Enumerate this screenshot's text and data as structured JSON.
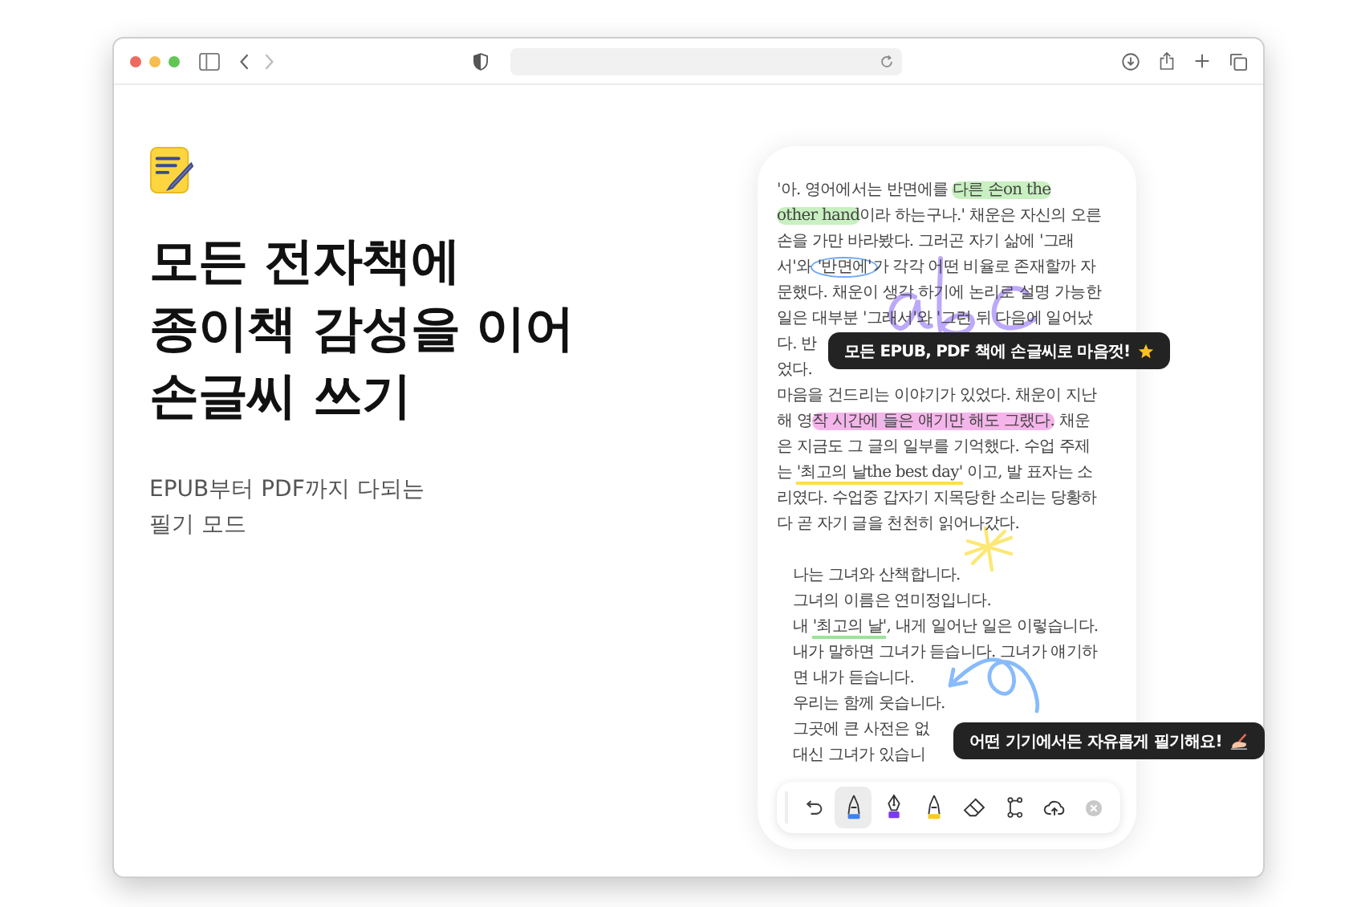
{
  "hero": {
    "title_lines": [
      "모든 전자책에",
      "종이책 감성을 이어",
      "손글씨 쓰기"
    ],
    "subtitle_lines": [
      "EPUB부터 PDF까지 다되는",
      "필기 모드"
    ]
  },
  "reader": {
    "paragraphs": [
      {
        "kind": "body",
        "lines": [
          [
            {
              "text": "'아. 영어에서는 반면에를 ",
              "kind": "plain"
            },
            {
              "text": "다른 손on the",
              "kind": "highlight",
              "color": "#c8f0c0"
            }
          ],
          [
            {
              "text": "other hand",
              "kind": "highlight",
              "color": "#c8f0c0"
            },
            {
              "text": "이라 하는구나.' 채운은 자신의 오른",
              "kind": "plain"
            }
          ],
          [
            {
              "text": "손을 가만 바라봤다. 그러곤 자기 삶에 '그래",
              "kind": "plain"
            }
          ],
          [
            {
              "text": "서'와 ",
              "kind": "plain"
            },
            {
              "text": "'반면에'",
              "kind": "circled",
              "color": "#6ea8f5"
            },
            {
              "text": "가 각각 어떤 비율로 존재할까 자",
              "kind": "plain"
            }
          ],
          [
            {
              "text": "문했다. 채운이 생각 하기에 논리로 설명 가능한",
              "kind": "plain"
            }
          ],
          [
            {
              "text": "일은 대부분 '그래서'와 '그런 뒤 다음에 일어났",
              "kind": "plain"
            }
          ],
          [
            {
              "text": "다. 반",
              "kind": "plain"
            }
          ],
          [
            {
              "text": "었다.",
              "kind": "plain"
            }
          ],
          [
            {
              "text": "마음을 건드리는 이야기가 있었다. 채운이 지난",
              "kind": "plain"
            }
          ],
          [
            {
              "text": "해 영",
              "kind": "plain"
            },
            {
              "text": "작 시간에 들은 얘기만 해도 그랬다.",
              "kind": "highlight",
              "color": "#f4b6ea"
            },
            {
              "text": " 채운",
              "kind": "plain"
            }
          ],
          [
            {
              "text": "은 지금도 그 글의 일부를 기억했다. 수업 주제",
              "kind": "plain"
            }
          ],
          [
            {
              "text": "는 ",
              "kind": "plain"
            },
            {
              "text": "'최고의 날the best day'",
              "kind": "underline",
              "color": "#fde047"
            },
            {
              "text": " 이고, 발 표자는 소",
              "kind": "plain"
            }
          ],
          [
            {
              "text": "리였다. 수업중 갑자기 지목당한 소리는 당황하",
              "kind": "plain"
            }
          ],
          [
            {
              "text": "다 곧 자기 글을 천천히 읽어나갔다.",
              "kind": "plain"
            }
          ]
        ]
      },
      {
        "kind": "quote",
        "lines": [
          [
            {
              "text": "나는 그녀와 산책합니다.",
              "kind": "plain"
            }
          ],
          [
            {
              "text": "그녀의 이름은 연미정입니다.",
              "kind": "plain"
            }
          ],
          [
            {
              "text": "내 ",
              "kind": "plain"
            },
            {
              "text": "'최고의 날'",
              "kind": "underline",
              "color": "#9be39b"
            },
            {
              "text": ", 내게 일어난 일은 이렇습니다.",
              "kind": "plain"
            }
          ],
          [
            {
              "text": "내가 말하면 그녀가 듣습니다.  그녀가 얘기하",
              "kind": "plain"
            }
          ],
          [
            {
              "text": "면 내가 듣습니다.",
              "kind": "plain"
            }
          ],
          [
            {
              "text": "우리는 함께 웃습니다.",
              "kind": "plain"
            }
          ],
          [
            {
              "text": "그곳에 큰 사전은 없",
              "kind": "plain"
            }
          ],
          [
            {
              "text": "대신 그녀가 있습니",
              "kind": "plain"
            }
          ]
        ]
      }
    ],
    "tooltips": [
      {
        "text": "모든 EPUB, PDF 책에 손글씨로 마음껏!"
      },
      {
        "text": "어떤 기기에서든 자유롭게 필기해요!"
      }
    ],
    "tools": [
      {
        "kind": "undo",
        "selected": false
      },
      {
        "kind": "pen",
        "selected": true,
        "color": "#3b82f6"
      },
      {
        "kind": "fountain-pen",
        "selected": false,
        "color": "#7c3aed"
      },
      {
        "kind": "highlighter",
        "selected": false,
        "color": "#facc15"
      },
      {
        "kind": "eraser",
        "selected": false
      },
      {
        "kind": "lasso",
        "selected": false
      },
      {
        "kind": "cloud",
        "selected": false
      },
      {
        "kind": "close",
        "selected": false
      }
    ]
  }
}
